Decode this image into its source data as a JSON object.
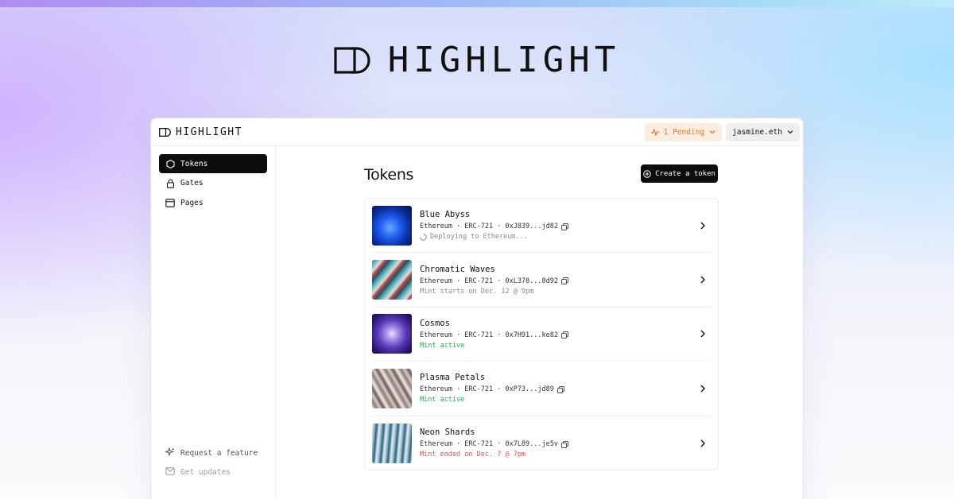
{
  "brand": {
    "name": "HIGHLIGHT"
  },
  "header": {
    "pending_label": "1 Pending",
    "account_label": "jasmine.eth"
  },
  "sidebar": {
    "items": [
      {
        "label": "Tokens",
        "icon": "hexagon-icon",
        "active": true
      },
      {
        "label": "Gates",
        "icon": "lock-icon",
        "active": false
      },
      {
        "label": "Pages",
        "icon": "browser-icon",
        "active": false
      }
    ],
    "bottom": [
      {
        "label": "Request a feature",
        "icon": "sparkle-icon"
      },
      {
        "label": "Get updates",
        "icon": "mail-icon"
      }
    ]
  },
  "main": {
    "title": "Tokens",
    "create_label": "Create a token",
    "tokens": [
      {
        "name": "Blue Abyss",
        "meta": "Ethereum · ERC-721 · 0xJ839...jd82",
        "status": "Deploying to Ethereum...",
        "status_color": "#8a8a92"
      },
      {
        "name": "Chromatic Waves",
        "meta": "Ethereum · ERC-721 · 0xL378...8d92",
        "status": "Mint starts on Dec. 12 @ 9pm",
        "status_color": "#8a8a92"
      },
      {
        "name": "Cosmos",
        "meta": "Ethereum · ERC-721 · 0x7H91...ke82",
        "status": "Mint active",
        "status_color": "#2fa84f"
      },
      {
        "name": "Plasma Petals",
        "meta": "Ethereum · ERC-721 · 0xP73...jd89",
        "status": "Mint active",
        "status_color": "#2fa84f"
      },
      {
        "name": "Neon Shards",
        "meta": "Ethereum · ERC-721 · 0x7L89...je5v",
        "status": "Mint ended on Dec. 7 @ 7pm",
        "status_color": "#e0544f"
      }
    ]
  },
  "colors": {
    "pending_bg": "#fdece0",
    "pending_fg": "#e07a2b",
    "active_nav": "#0c0c0c"
  }
}
